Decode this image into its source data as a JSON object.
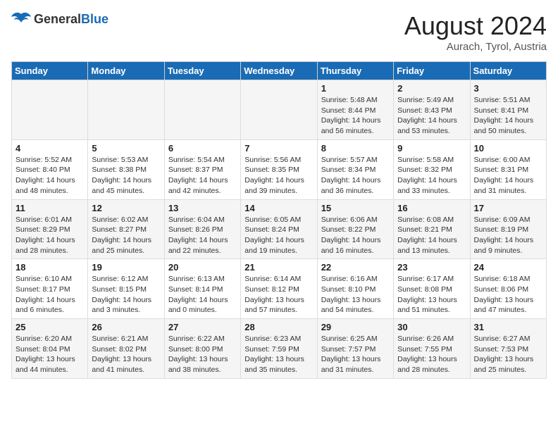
{
  "header": {
    "logo_general": "General",
    "logo_blue": "Blue",
    "month_year": "August 2024",
    "location": "Aurach, Tyrol, Austria"
  },
  "days_of_week": [
    "Sunday",
    "Monday",
    "Tuesday",
    "Wednesday",
    "Thursday",
    "Friday",
    "Saturday"
  ],
  "weeks": [
    [
      {
        "day": "",
        "info": ""
      },
      {
        "day": "",
        "info": ""
      },
      {
        "day": "",
        "info": ""
      },
      {
        "day": "",
        "info": ""
      },
      {
        "day": "1",
        "info": "Sunrise: 5:48 AM\nSunset: 8:44 PM\nDaylight: 14 hours\nand 56 minutes."
      },
      {
        "day": "2",
        "info": "Sunrise: 5:49 AM\nSunset: 8:43 PM\nDaylight: 14 hours\nand 53 minutes."
      },
      {
        "day": "3",
        "info": "Sunrise: 5:51 AM\nSunset: 8:41 PM\nDaylight: 14 hours\nand 50 minutes."
      }
    ],
    [
      {
        "day": "4",
        "info": "Sunrise: 5:52 AM\nSunset: 8:40 PM\nDaylight: 14 hours\nand 48 minutes."
      },
      {
        "day": "5",
        "info": "Sunrise: 5:53 AM\nSunset: 8:38 PM\nDaylight: 14 hours\nand 45 minutes."
      },
      {
        "day": "6",
        "info": "Sunrise: 5:54 AM\nSunset: 8:37 PM\nDaylight: 14 hours\nand 42 minutes."
      },
      {
        "day": "7",
        "info": "Sunrise: 5:56 AM\nSunset: 8:35 PM\nDaylight: 14 hours\nand 39 minutes."
      },
      {
        "day": "8",
        "info": "Sunrise: 5:57 AM\nSunset: 8:34 PM\nDaylight: 14 hours\nand 36 minutes."
      },
      {
        "day": "9",
        "info": "Sunrise: 5:58 AM\nSunset: 8:32 PM\nDaylight: 14 hours\nand 33 minutes."
      },
      {
        "day": "10",
        "info": "Sunrise: 6:00 AM\nSunset: 8:31 PM\nDaylight: 14 hours\nand 31 minutes."
      }
    ],
    [
      {
        "day": "11",
        "info": "Sunrise: 6:01 AM\nSunset: 8:29 PM\nDaylight: 14 hours\nand 28 minutes."
      },
      {
        "day": "12",
        "info": "Sunrise: 6:02 AM\nSunset: 8:27 PM\nDaylight: 14 hours\nand 25 minutes."
      },
      {
        "day": "13",
        "info": "Sunrise: 6:04 AM\nSunset: 8:26 PM\nDaylight: 14 hours\nand 22 minutes."
      },
      {
        "day": "14",
        "info": "Sunrise: 6:05 AM\nSunset: 8:24 PM\nDaylight: 14 hours\nand 19 minutes."
      },
      {
        "day": "15",
        "info": "Sunrise: 6:06 AM\nSunset: 8:22 PM\nDaylight: 14 hours\nand 16 minutes."
      },
      {
        "day": "16",
        "info": "Sunrise: 6:08 AM\nSunset: 8:21 PM\nDaylight: 14 hours\nand 13 minutes."
      },
      {
        "day": "17",
        "info": "Sunrise: 6:09 AM\nSunset: 8:19 PM\nDaylight: 14 hours\nand 9 minutes."
      }
    ],
    [
      {
        "day": "18",
        "info": "Sunrise: 6:10 AM\nSunset: 8:17 PM\nDaylight: 14 hours\nand 6 minutes."
      },
      {
        "day": "19",
        "info": "Sunrise: 6:12 AM\nSunset: 8:15 PM\nDaylight: 14 hours\nand 3 minutes."
      },
      {
        "day": "20",
        "info": "Sunrise: 6:13 AM\nSunset: 8:14 PM\nDaylight: 14 hours\nand 0 minutes."
      },
      {
        "day": "21",
        "info": "Sunrise: 6:14 AM\nSunset: 8:12 PM\nDaylight: 13 hours\nand 57 minutes."
      },
      {
        "day": "22",
        "info": "Sunrise: 6:16 AM\nSunset: 8:10 PM\nDaylight: 13 hours\nand 54 minutes."
      },
      {
        "day": "23",
        "info": "Sunrise: 6:17 AM\nSunset: 8:08 PM\nDaylight: 13 hours\nand 51 minutes."
      },
      {
        "day": "24",
        "info": "Sunrise: 6:18 AM\nSunset: 8:06 PM\nDaylight: 13 hours\nand 47 minutes."
      }
    ],
    [
      {
        "day": "25",
        "info": "Sunrise: 6:20 AM\nSunset: 8:04 PM\nDaylight: 13 hours\nand 44 minutes."
      },
      {
        "day": "26",
        "info": "Sunrise: 6:21 AM\nSunset: 8:02 PM\nDaylight: 13 hours\nand 41 minutes."
      },
      {
        "day": "27",
        "info": "Sunrise: 6:22 AM\nSunset: 8:00 PM\nDaylight: 13 hours\nand 38 minutes."
      },
      {
        "day": "28",
        "info": "Sunrise: 6:23 AM\nSunset: 7:59 PM\nDaylight: 13 hours\nand 35 minutes."
      },
      {
        "day": "29",
        "info": "Sunrise: 6:25 AM\nSunset: 7:57 PM\nDaylight: 13 hours\nand 31 minutes."
      },
      {
        "day": "30",
        "info": "Sunrise: 6:26 AM\nSunset: 7:55 PM\nDaylight: 13 hours\nand 28 minutes."
      },
      {
        "day": "31",
        "info": "Sunrise: 6:27 AM\nSunset: 7:53 PM\nDaylight: 13 hours\nand 25 minutes."
      }
    ]
  ]
}
